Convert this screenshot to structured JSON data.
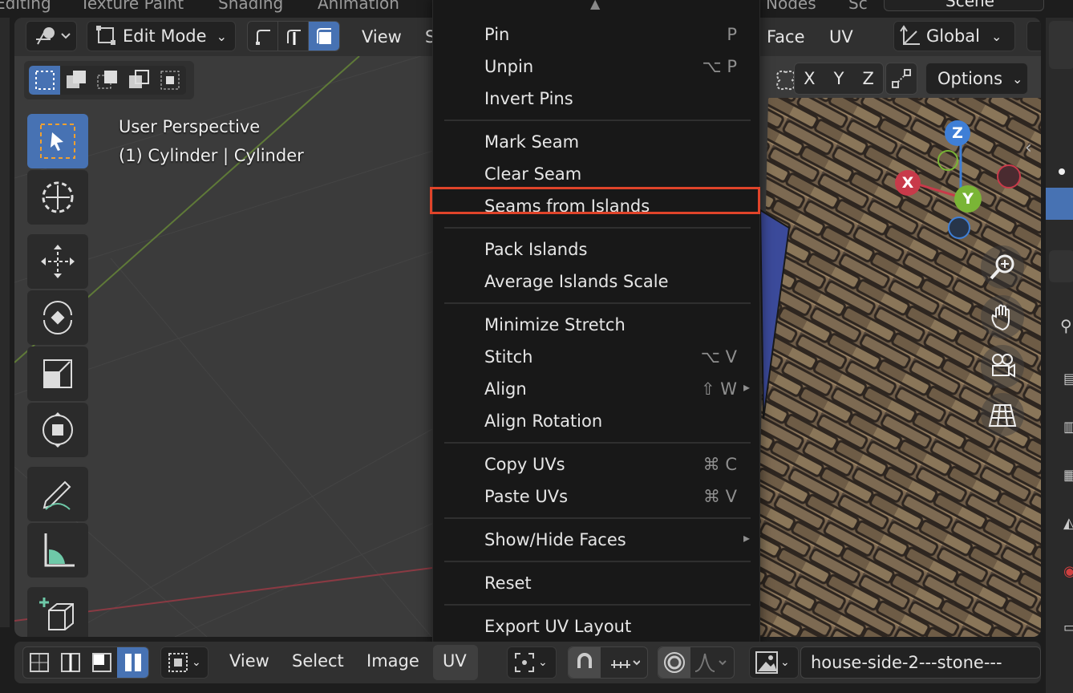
{
  "workspace_tabs": [
    "Editing",
    "Texture Paint",
    "Shading",
    "Animation",
    "Nodes",
    "Sc"
  ],
  "scene_field": "Scene",
  "header": {
    "mode": "Edit Mode",
    "menu_view": "View",
    "menu_select_partial": "S",
    "menu_face": "Face",
    "menu_uv": "UV",
    "orientation": "Global",
    "options": "Options",
    "axis_x": "X",
    "axis_y": "Y",
    "axis_z": "Z"
  },
  "viewport": {
    "perspective": "User Perspective",
    "object": "(1) Cylinder | Cylinder",
    "gizmo": {
      "x": "X",
      "y": "Y",
      "z": "Z"
    }
  },
  "uv_menu": {
    "items": [
      {
        "label": "Pin",
        "shortcut": "P"
      },
      {
        "label": "Unpin",
        "shortcut": "⌥ P"
      },
      {
        "label": "Invert Pins",
        "shortcut": ""
      },
      {
        "label": "Mark Seam",
        "shortcut": ""
      },
      {
        "label": "Clear Seam",
        "shortcut": ""
      },
      {
        "label": "Seams from Islands",
        "shortcut": ""
      },
      {
        "label": "Pack Islands",
        "shortcut": ""
      },
      {
        "label": "Average Islands Scale",
        "shortcut": ""
      },
      {
        "label": "Minimize Stretch",
        "shortcut": ""
      },
      {
        "label": "Stitch",
        "shortcut": "⌥ V"
      },
      {
        "label": "Align",
        "shortcut": "⇧ W"
      },
      {
        "label": "Align Rotation",
        "shortcut": ""
      },
      {
        "label": "Copy UVs",
        "shortcut": "⌘ C"
      },
      {
        "label": "Paste UVs",
        "shortcut": "⌘ V"
      },
      {
        "label": "Show/Hide Faces",
        "shortcut": ""
      },
      {
        "label": "Reset",
        "shortcut": ""
      },
      {
        "label": "Export UV Layout",
        "shortcut": ""
      }
    ],
    "highlighted": "Seams from Islands",
    "highlight_color": "#e0442a"
  },
  "bottom_bar": {
    "view": "View",
    "select": "Select",
    "image": "Image",
    "uv": "UV",
    "image_name": "house-side-2---stone---"
  },
  "colors": {
    "accent": "#4772b3",
    "axis_x": "#c83a4a",
    "axis_y": "#7ab536",
    "axis_z": "#3f7fd6"
  }
}
